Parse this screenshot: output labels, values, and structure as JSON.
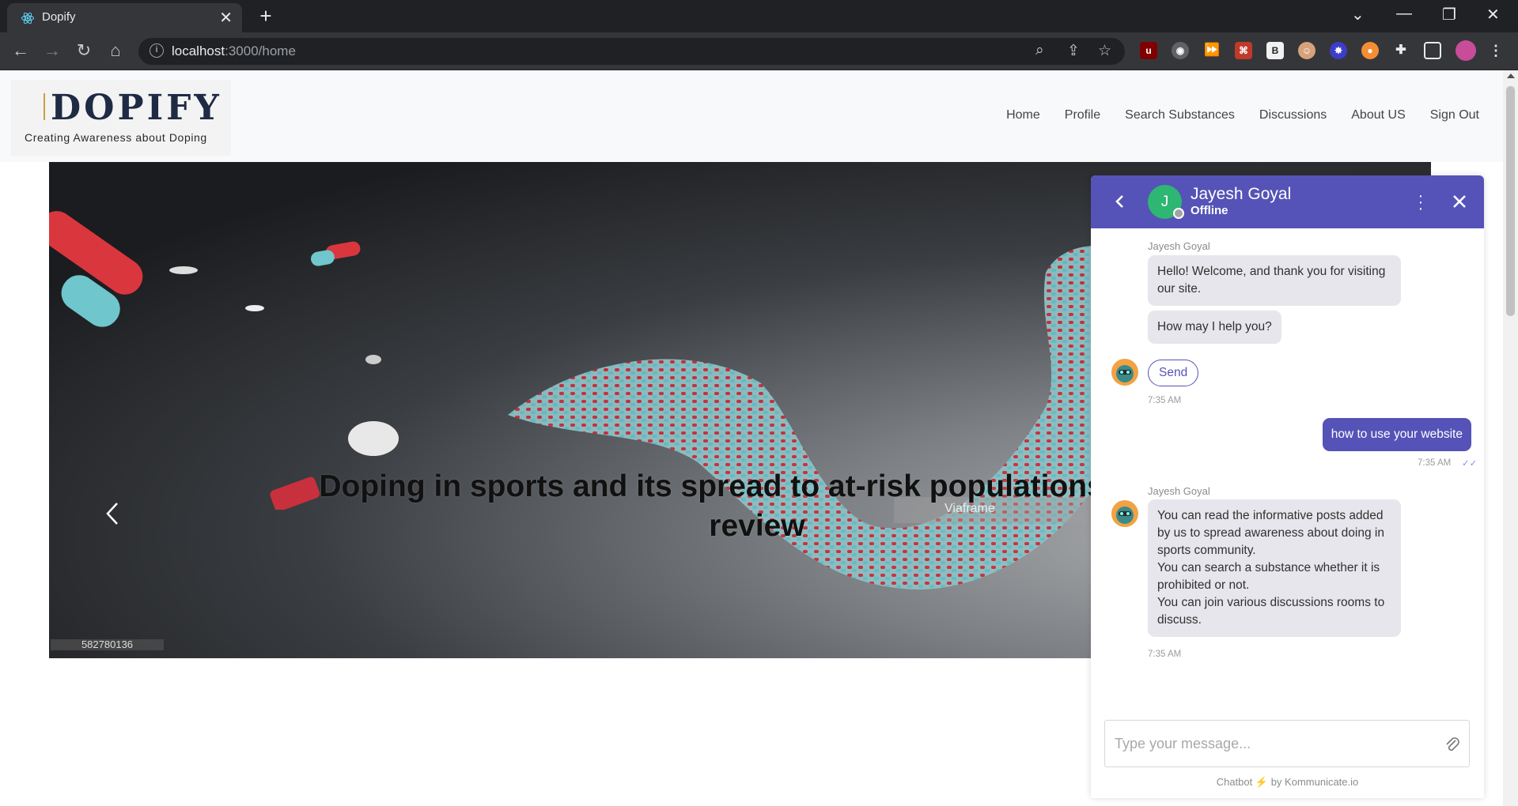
{
  "browser": {
    "tab_title": "Dopify",
    "url_host": "localhost",
    "url_path": ":3000/home"
  },
  "site": {
    "logo_name": "DOPIFY",
    "logo_tagline": "Creating Awareness about Doping",
    "nav": [
      "Home",
      "Profile",
      "Search Substances",
      "Discussions",
      "About US",
      "Sign Out"
    ]
  },
  "carousel": {
    "caption_line1": "Doping in sports and its spread to at-risk populations: an in",
    "caption_line2": "review",
    "stock_id": "582780136",
    "watermark": "Viaframe"
  },
  "chat": {
    "agent_initial": "J",
    "agent_name": "Jayesh Goyal",
    "agent_status": "Offline",
    "sender_label": "Jayesh Goyal",
    "msg_welcome": "Hello! Welcome, and thank you for visiting our site.",
    "msg_help": "How may I help you?",
    "quick_reply": "Send",
    "time_1": "7:35 AM",
    "user_msg": "how to use your website",
    "time_user": "7:35 AM",
    "sender_label_2": "Jayesh Goyal",
    "msg_info_1": "You can read the informative posts added by us to spread awareness about doing in sports community.",
    "msg_info_2": "You can search a substance whether it is prohibited or not.",
    "msg_info_3": "You can join various discussions rooms to discuss.",
    "time_2": "7:35 AM",
    "input_placeholder": "Type your message...",
    "powered_prefix": "Chatbot",
    "powered_suffix": "by Kommunicate.io"
  },
  "colors": {
    "chat_accent": "#5553b7",
    "agent_avatar": "#2eb673"
  }
}
